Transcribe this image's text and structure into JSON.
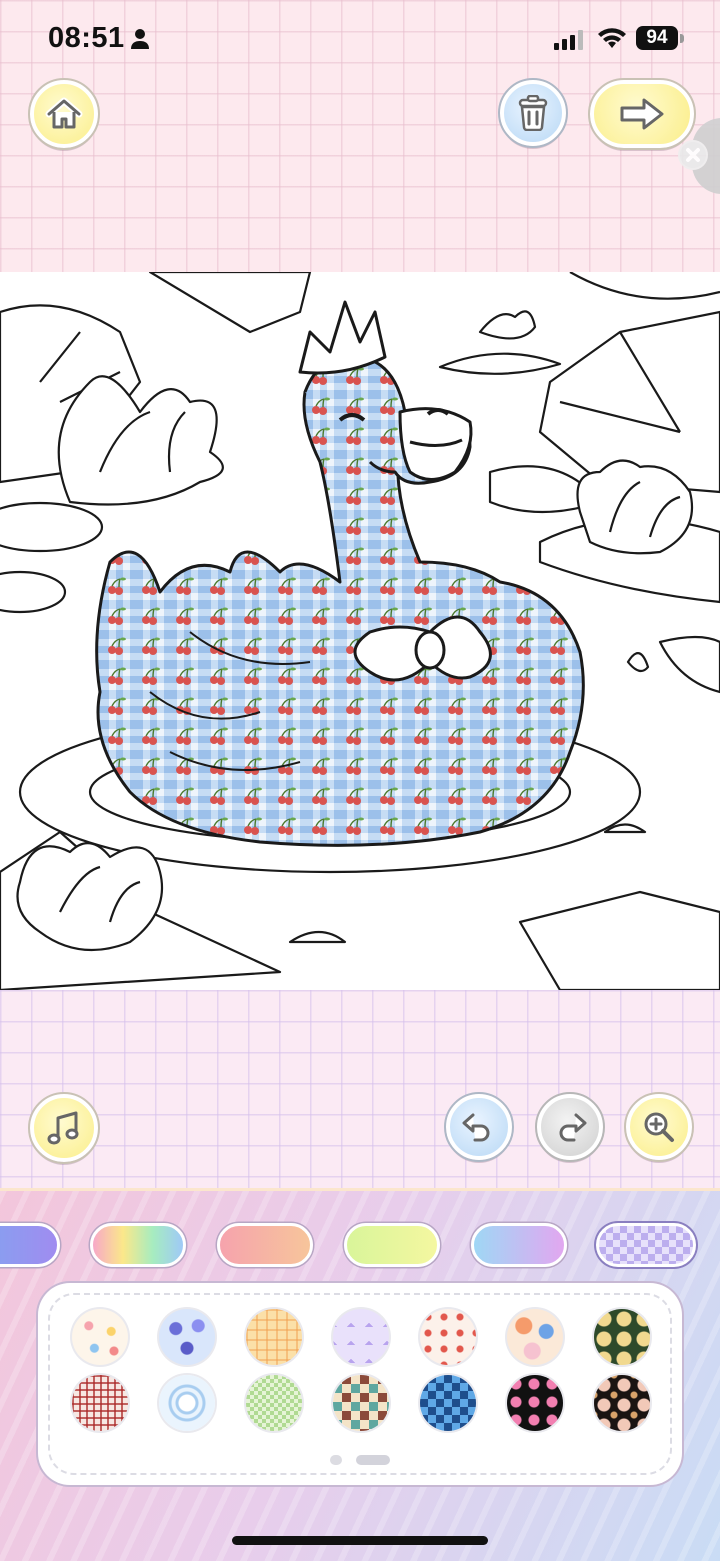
{
  "status_bar": {
    "time": "08:51",
    "battery": "94"
  },
  "toolbar_top": {
    "home_icon": "home-icon",
    "trash_icon": "trash-icon",
    "next_icon": "arrow-right-icon",
    "close_icon": "close-icon"
  },
  "canvas": {
    "subject": "swan-with-crown-and-bow",
    "fill_pattern": "blue-gingham-cherries",
    "colors": {
      "gingham": "#bcd6f2",
      "cherry": "#d9534f",
      "line": "#1a1a1a"
    }
  },
  "toolbar_bottom": {
    "music_icon": "music-note-icon",
    "undo_icon": "undo-icon",
    "redo_icon": "redo-icon",
    "zoom_icon": "zoom-in-icon"
  },
  "categories": [
    {
      "name": "blue-gradient",
      "selected": false
    },
    {
      "name": "rainbow",
      "selected": false
    },
    {
      "name": "peach",
      "selected": false
    },
    {
      "name": "lime",
      "selected": false
    },
    {
      "name": "blue-pink",
      "selected": false
    },
    {
      "name": "pattern-gingham",
      "selected": true
    }
  ],
  "swatches": [
    "floral-cream",
    "blue-tulips",
    "bears-plaid",
    "lavender-tiles",
    "strawberry-dots",
    "retro-flowers",
    "green-damask",
    "red-plaid",
    "blue-circles",
    "green-gingham",
    "patchwork",
    "blue-argyle",
    "pink-hearts",
    "black-floral"
  ],
  "pager": {
    "current_page": 2,
    "total_pages": 2
  }
}
